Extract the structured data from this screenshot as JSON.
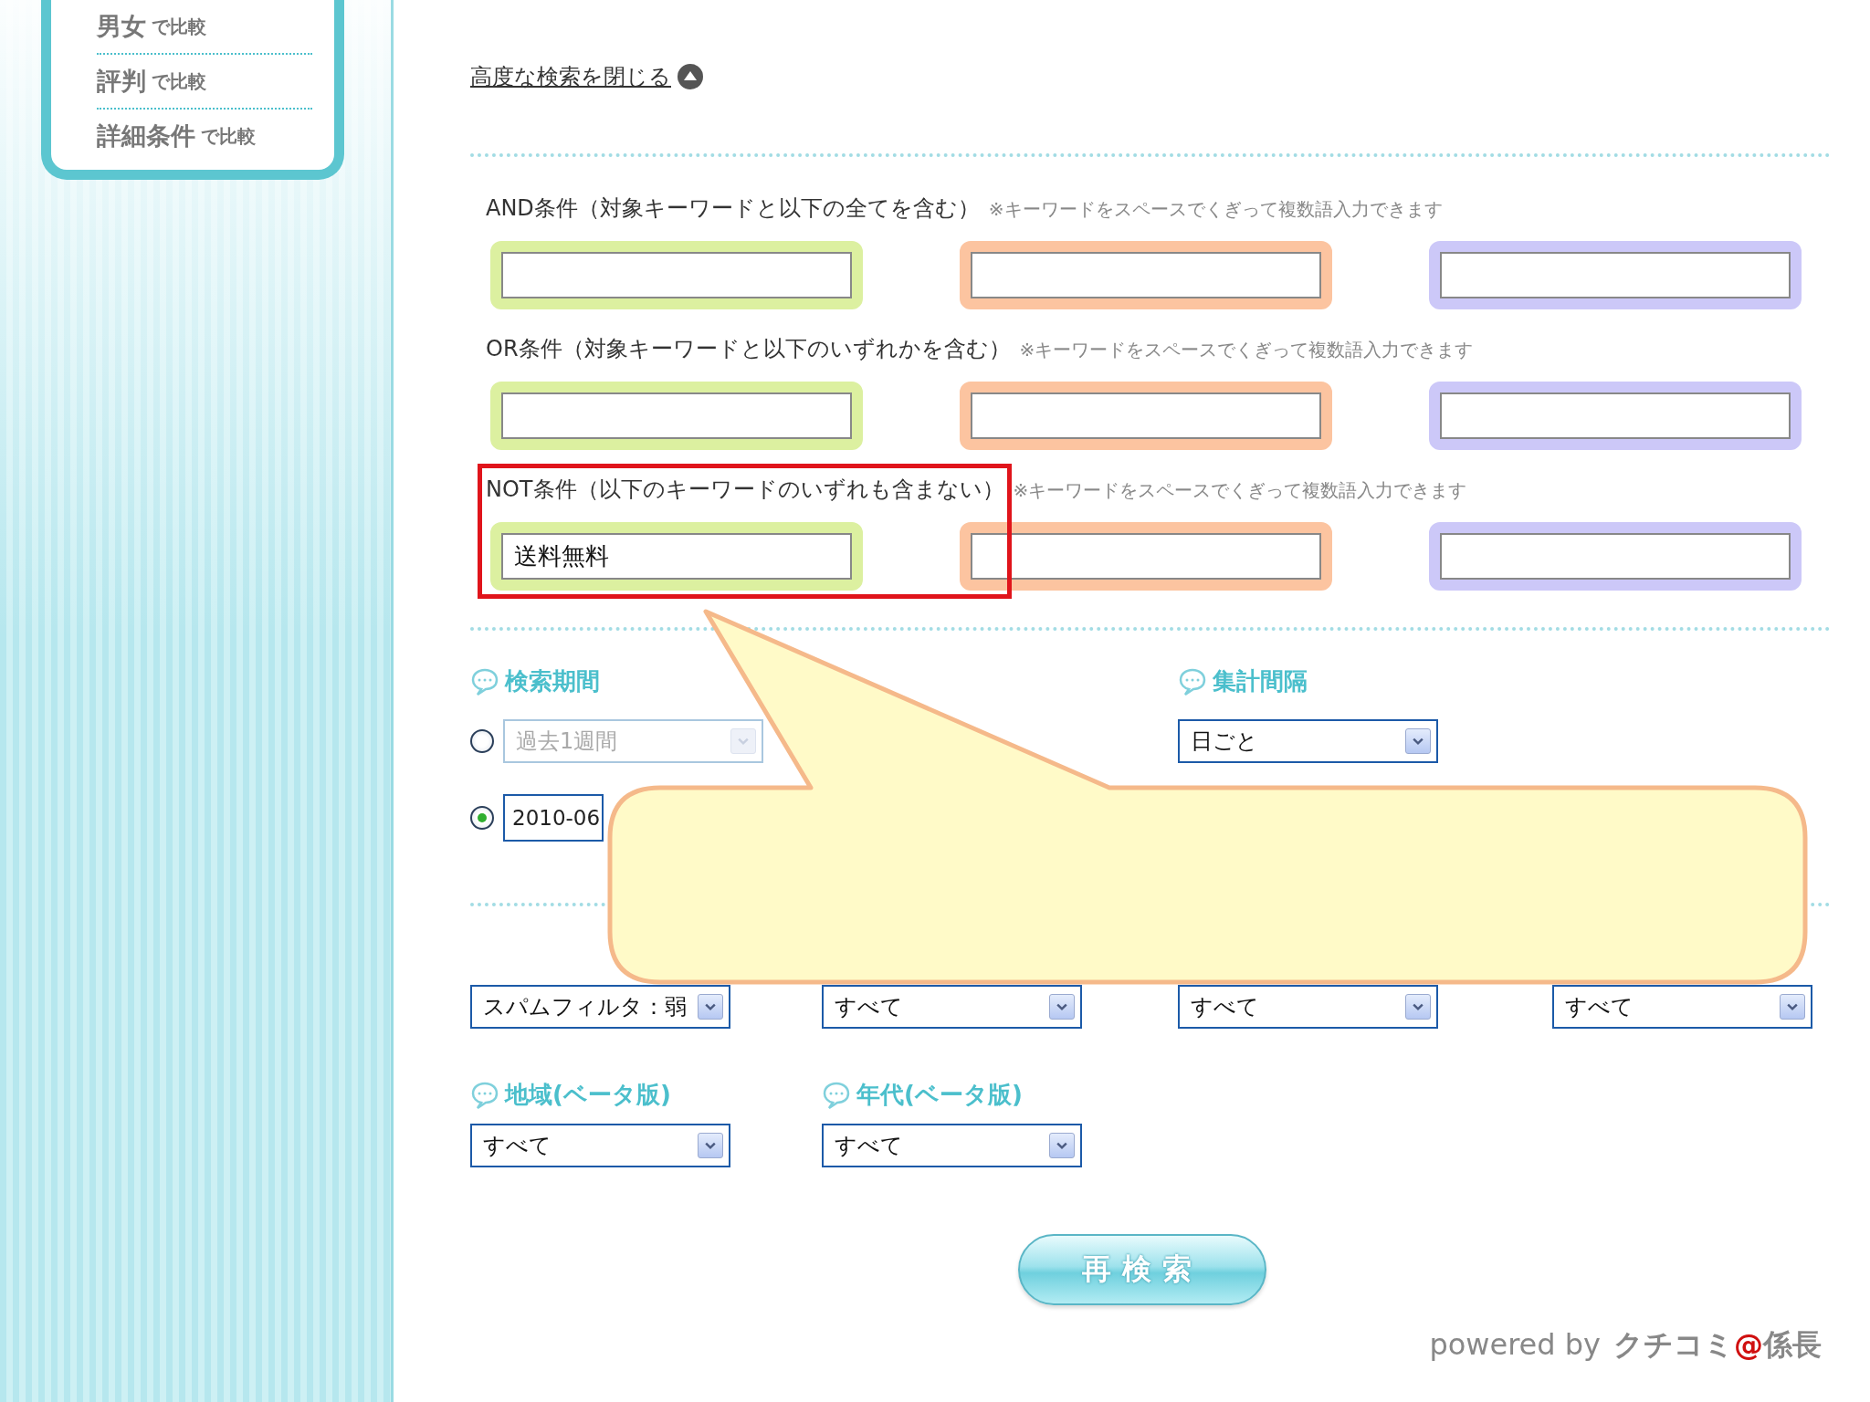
{
  "sidebar": {
    "items": [
      {
        "keyword": "男女",
        "suffix": "で比較"
      },
      {
        "keyword": "評判",
        "suffix": "で比較"
      },
      {
        "keyword": "詳細条件",
        "suffix": "で比較"
      }
    ]
  },
  "advanced_toggle": {
    "label": "高度な検索を閉じる"
  },
  "keyword_groups": [
    {
      "label": "AND条件（対象キーワードと以下の全てを含む）",
      "hint": "※キーワードをスペースでくぎって複数語入力できます",
      "highlighted": false,
      "fields": [
        {
          "color": "#dcf0a0"
        },
        {
          "color": "#fcc4a0"
        },
        {
          "color": "#ccc8f8"
        }
      ]
    },
    {
      "label": "OR条件（対象キーワードと以下のいずれかを含む）",
      "hint": "※キーワードをスペースでくぎって複数語入力できます",
      "highlighted": false,
      "fields": [
        {
          "color": "#dcf0a0"
        },
        {
          "color": "#fcc4a0"
        },
        {
          "color": "#ccc8f8"
        }
      ]
    },
    {
      "label": "NOT条件（以下のキーワードのいずれも含まない）",
      "hint": "※キーワードをスペースでくぎって複数語入力できます",
      "highlighted": true,
      "fields": [
        {
          "color": "#dcf0a0",
          "value": "送料無料"
        },
        {
          "color": "#fcc4a0"
        },
        {
          "color": "#ccc8f8"
        }
      ]
    }
  ],
  "period": {
    "label": "検索期間",
    "options": [
      {
        "kind": "select",
        "selected": false,
        "disabled": true,
        "value": "過去1週間"
      },
      {
        "kind": "date",
        "selected": true,
        "disabled": false,
        "value": "2010-06"
      }
    ]
  },
  "interval": {
    "label": "集計間隔",
    "value": "日ごと"
  },
  "filters": [
    {
      "value": "スパムフィルタ：弱"
    },
    {
      "value": "すべて"
    },
    {
      "value": "すべて"
    },
    {
      "value": "すべて"
    },
    {
      "label": "地域(ベータ版)",
      "value": "すべて"
    },
    {
      "label": "年代(ベータ版)",
      "value": "すべて"
    }
  ],
  "search_button": {
    "label": "再検索"
  },
  "footer": {
    "prefix": "powered by",
    "brand": "クチコミ",
    "brand_mark": "@",
    "brand_suffix": "係長"
  }
}
